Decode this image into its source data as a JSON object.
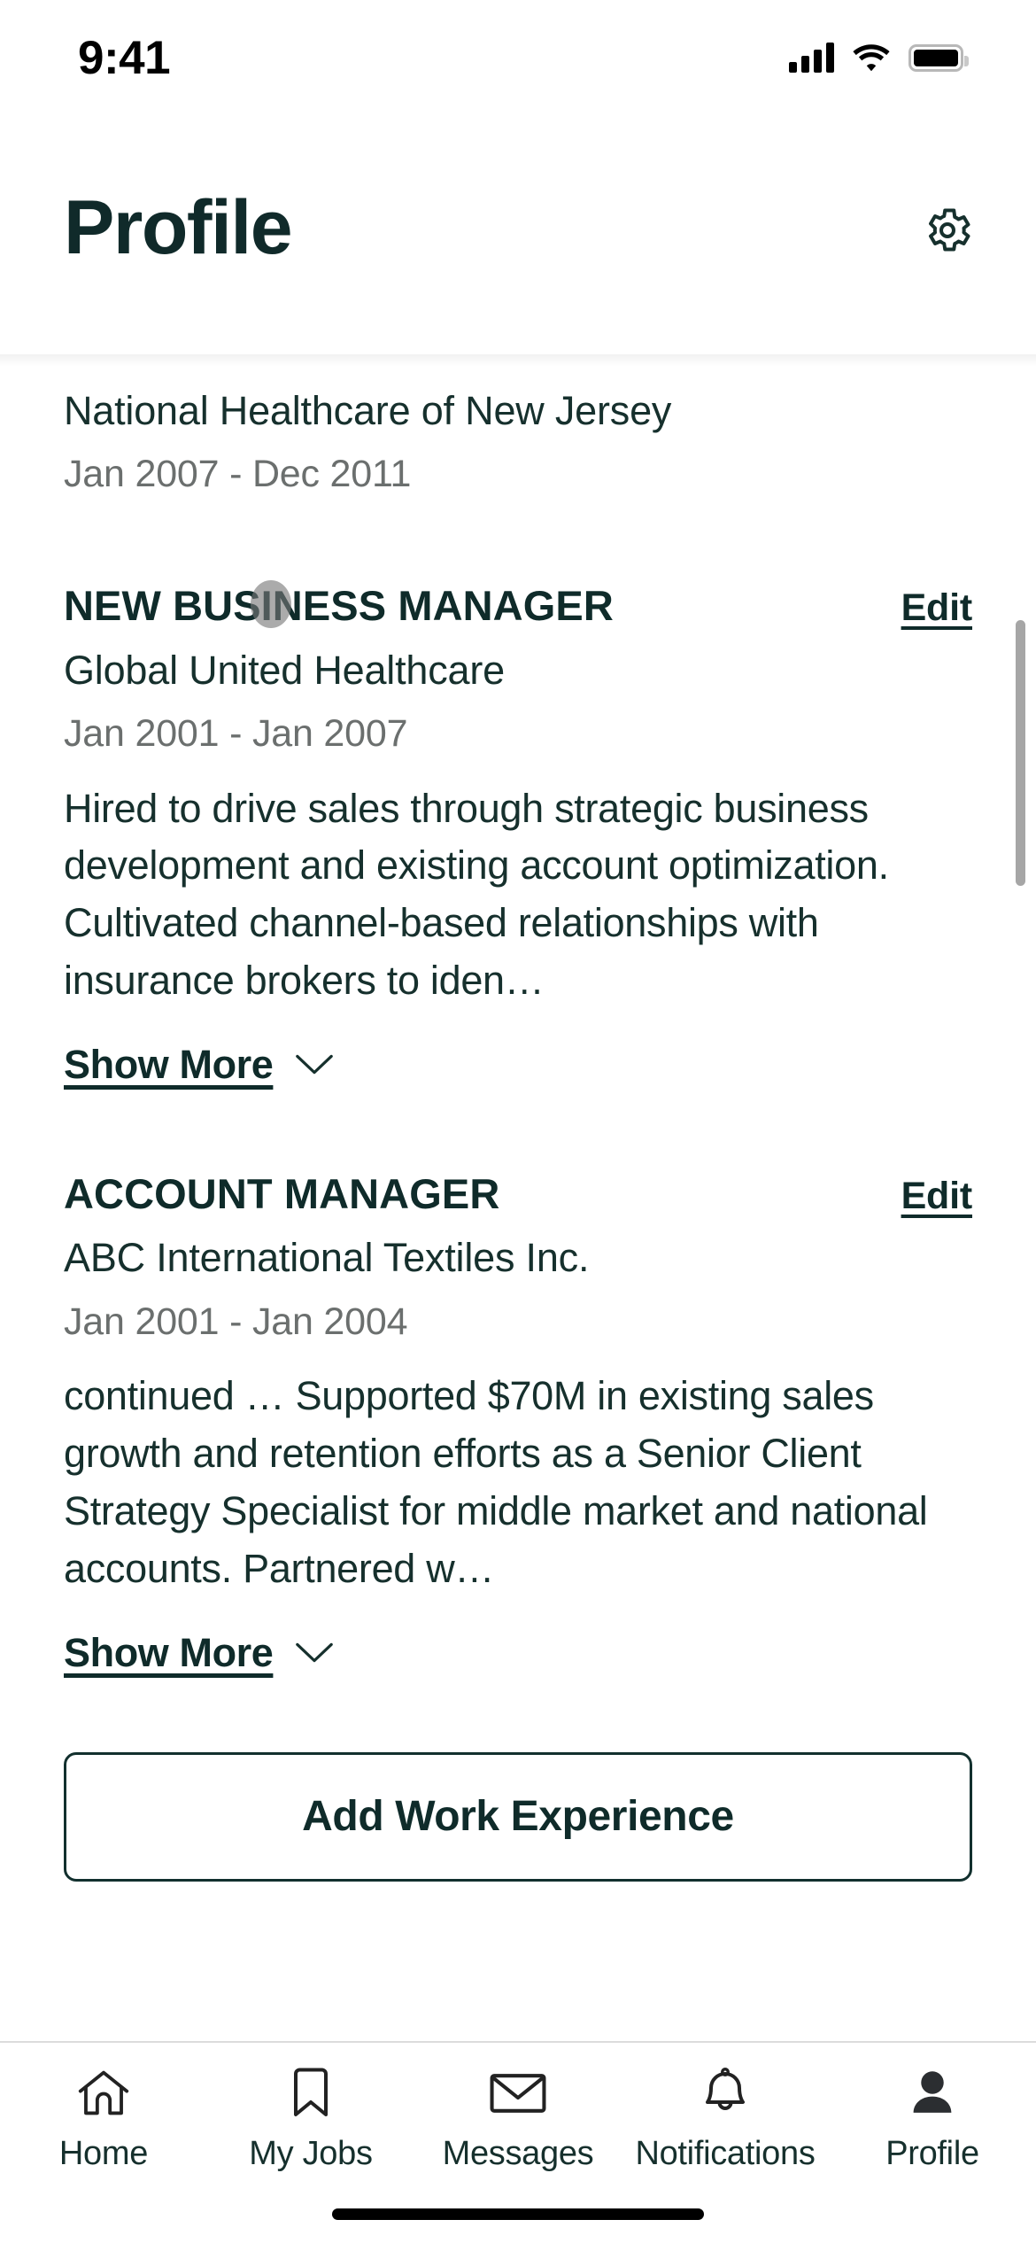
{
  "status_bar": {
    "time": "9:41",
    "signal_icon": "cellular-signal-icon",
    "wifi_icon": "wifi-icon",
    "battery_icon": "battery-full-icon"
  },
  "header": {
    "title": "Profile",
    "settings_icon": "gear-icon"
  },
  "colors": {
    "brand_dark": "#0f2b2a",
    "muted_text": "#6b6f6e",
    "border": "#dcdcdc"
  },
  "experience": {
    "partial_entry": {
      "company": "National Healthcare of New Jersey",
      "dates": "Jan 2007 - Dec 2011"
    },
    "entries": [
      {
        "title": "NEW BUSINESS MANAGER",
        "edit_label": "Edit",
        "company": "Global United Healthcare",
        "dates": "Jan 2001 - Jan 2007",
        "description": "Hired to drive sales through strategic business development and existing account optimization. Cultivated channel-based relationships with insurance brokers to iden…",
        "show_more_label": "Show More",
        "chevron_icon": "chevron-down-icon"
      },
      {
        "title": "ACCOUNT MANAGER",
        "edit_label": "Edit",
        "company": "ABC International Textiles Inc.",
        "dates": "Jan 2001 - Jan 2004",
        "description": "continued … Supported $70M in existing sales growth and retention efforts as a Senior Client Strategy Specialist for middle market  and national accounts. Partnered w…",
        "show_more_label": "Show More",
        "chevron_icon": "chevron-down-icon"
      }
    ],
    "add_button_label": "Add Work Experience"
  },
  "tab_bar": {
    "items": [
      {
        "label": "Home",
        "icon": "home-icon",
        "active": false
      },
      {
        "label": "My Jobs",
        "icon": "bookmark-icon",
        "active": false
      },
      {
        "label": "Messages",
        "icon": "envelope-icon",
        "active": false
      },
      {
        "label": "Notifications",
        "icon": "bell-icon",
        "active": false
      },
      {
        "label": "Profile",
        "icon": "person-filled-icon",
        "active": true
      }
    ]
  }
}
